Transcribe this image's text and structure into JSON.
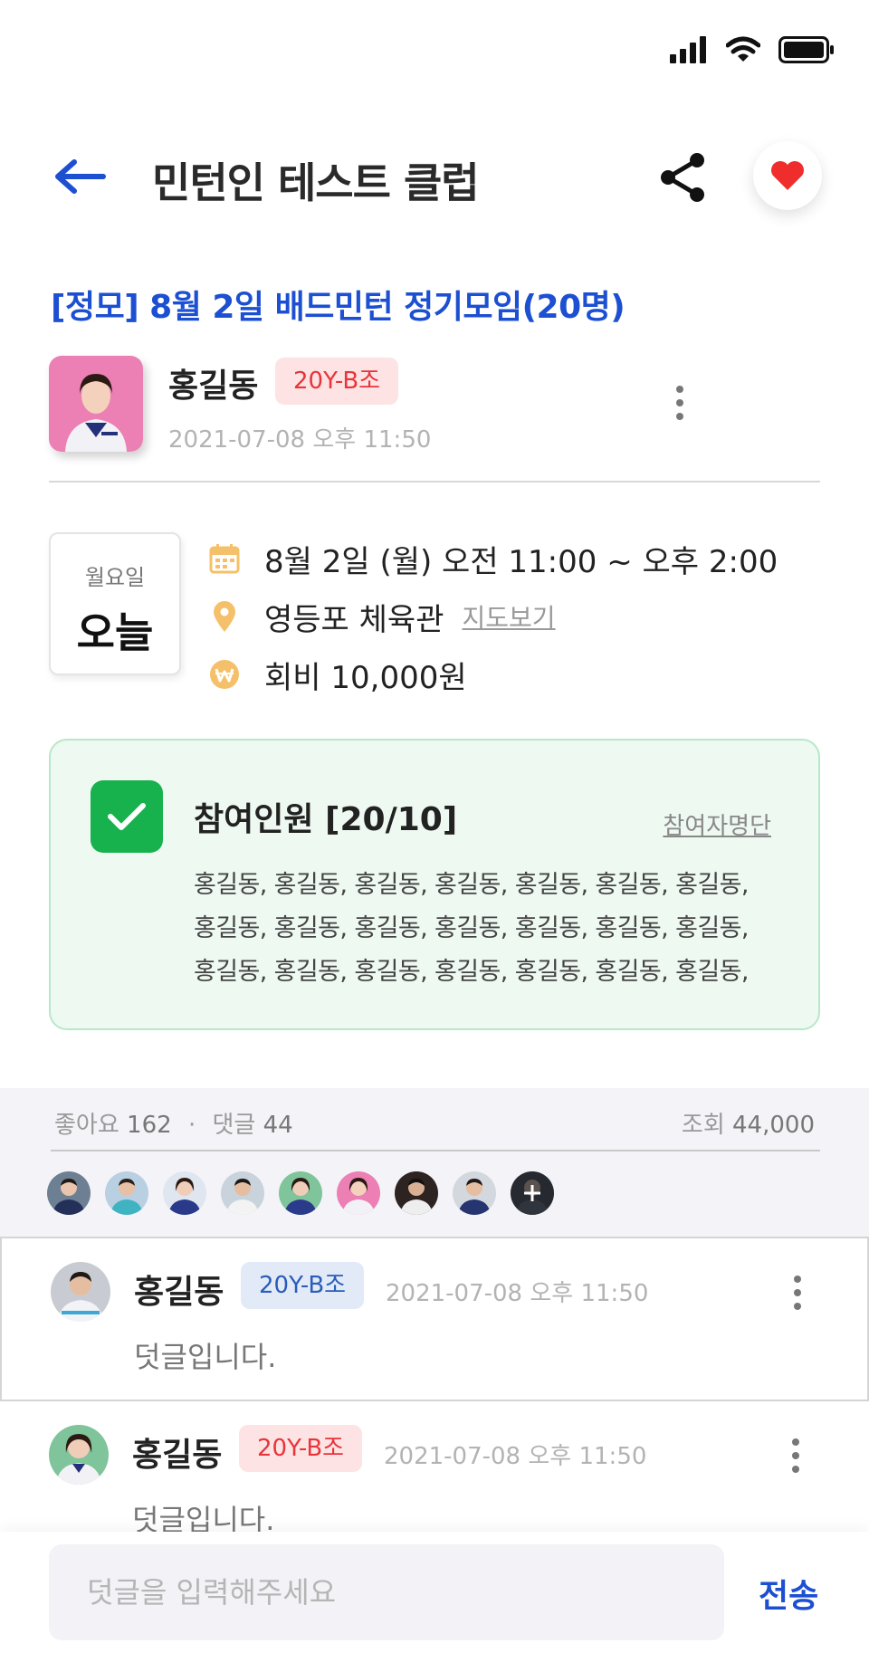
{
  "colors": {
    "accent": "#1c4fd1",
    "like": "#f02d2d",
    "badge_red": "#e8343a",
    "badge_blue": "#2a5cb8",
    "check_green": "#17b14e",
    "attend_bg": "#eef9f1"
  },
  "header": {
    "title": "민턴인 테스트 클럽"
  },
  "post": {
    "title": "[정모] 8월 2일 배드민턴 정기모임(20명)",
    "author": {
      "name": "홍길동",
      "badge": "20Y-B조",
      "date": "2021-07-08 오후 11:50"
    }
  },
  "schedule": {
    "weekday": "월요일",
    "day_label": "오늘",
    "datetime": "8월 2일 (월) 오전 11:00 ~ 오후 2:00",
    "location": "영등포 체육관",
    "map_link": "지도보기",
    "fee": "회비 10,000원"
  },
  "attendance": {
    "title": "참여인원 [20/10]",
    "list_link": "참여자명단",
    "lines": [
      "홍길동, 홍길동, 홍길동, 홍길동, 홍길동, 홍길동, 홍길동,",
      "홍길동, 홍길동, 홍길동, 홍길동, 홍길동, 홍길동, 홍길동,",
      "홍길동, 홍길동, 홍길동, 홍길동, 홍길동, 홍길동, 홍길동,"
    ]
  },
  "stats": {
    "likes_label": "좋아요",
    "likes": "162",
    "separator": "·",
    "comments_label": "댓글",
    "comments": "44",
    "views_label": "조회",
    "views": "44,000"
  },
  "comments": [
    {
      "name": "홍길동",
      "badge": "20Y-B조",
      "date": "2021-07-08 오후 11:50",
      "text": "덧글입니다."
    },
    {
      "name": "홍길동",
      "badge": "20Y-B조",
      "date": "2021-07-08 오후 11:50",
      "text": "덧글입니다."
    }
  ],
  "input": {
    "placeholder": "덧글을 입력해주세요",
    "send_label": "전송"
  }
}
